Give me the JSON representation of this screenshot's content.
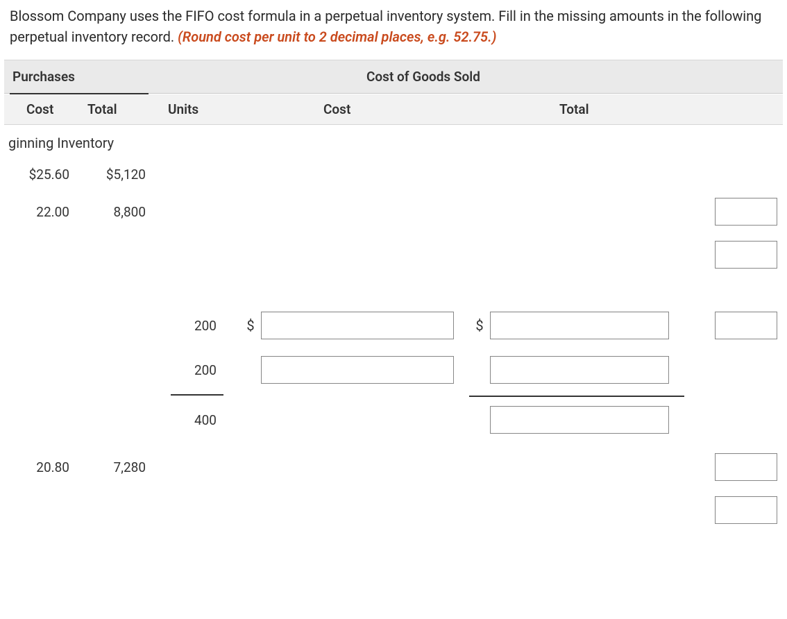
{
  "instructions": {
    "text_part1": "Blossom Company uses the FIFO cost formula in a perpetual inventory system. Fill in the missing amounts in the following perpetual inventory record. ",
    "text_emphasis": "(Round cost per unit to 2 decimal places, e.g. 52.75.)"
  },
  "headers": {
    "group_purchases": "Purchases",
    "group_cogs": "Cost of Goods Sold",
    "col_cost": "Cost",
    "col_total": "Total",
    "col_units": "Units"
  },
  "rows": {
    "beginning_inventory_label": "ginning Inventory",
    "r1": {
      "cost": "$25.60",
      "total": "$5,120"
    },
    "r2": {
      "cost": "22.00",
      "total": "8,800"
    },
    "r_cogs1": {
      "units": "200",
      "dollar": "$"
    },
    "r_cogs2": {
      "units": "200"
    },
    "r_cogs_total": {
      "units": "400"
    },
    "r3": {
      "cost": "20.80",
      "total": "7,280"
    }
  },
  "inputs": {
    "cost_1": "",
    "cost_2": "",
    "total_1": "",
    "total_2": "",
    "total_3": "",
    "right_1": "",
    "right_2": "",
    "right_3": "",
    "right_4": "",
    "right_5": ""
  }
}
